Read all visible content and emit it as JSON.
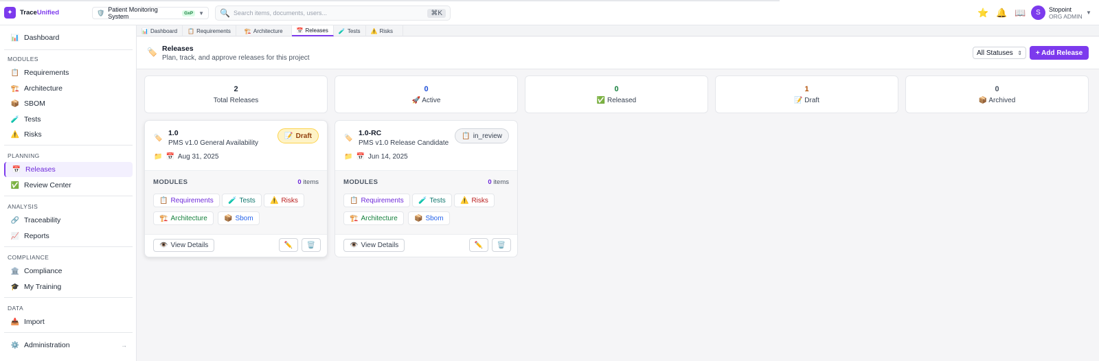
{
  "app": {
    "brand_prefix": "Trace",
    "brand_suffix": "Unified",
    "project": "Patient Monitoring System",
    "project_badge": "GxP",
    "search_placeholder": "Search items, documents, users...",
    "search_shortcut": "⌘K",
    "user_initial": "S",
    "user_name": "Stopoint",
    "user_role": "ORG ADMIN",
    "accent_color": "#7c3aed"
  },
  "sidebar": {
    "dashboard": "Dashboard",
    "sections": {
      "modules": "MODULES",
      "planning": "PLANNING",
      "analysis": "ANALYSIS",
      "compliance": "COMPLIANCE",
      "data": "DATA"
    },
    "items": {
      "requirements": "Requirements",
      "architecture": "Architecture",
      "sbom": "SBOM",
      "tests": "Tests",
      "risks": "Risks",
      "releases": "Releases",
      "review_center": "Review Center",
      "traceability": "Traceability",
      "reports": "Reports",
      "compliance": "Compliance",
      "my_training": "My Training",
      "import": "Import",
      "administration": "Administration"
    }
  },
  "tabs": [
    "Dashboard",
    "Requirements",
    "Architecture",
    "Releases",
    "Tests",
    "Risks"
  ],
  "page": {
    "title": "Releases",
    "subtitle": "Plan, track, and approve releases for this project",
    "status_filter": "All Statuses",
    "add_button": "+ Add Release"
  },
  "stats": [
    {
      "value": "2",
      "label": "Total Releases",
      "icon": "",
      "color": "#111827"
    },
    {
      "value": "0",
      "label": "Active",
      "icon": "🚀",
      "color": "#1d4ed8"
    },
    {
      "value": "0",
      "label": "Released",
      "icon": "✅",
      "color": "#15803d"
    },
    {
      "value": "1",
      "label": "Draft",
      "icon": "📝",
      "color": "#b45309"
    },
    {
      "value": "0",
      "label": "Archived",
      "icon": "📦",
      "color": "#4b5563"
    }
  ],
  "releases": [
    {
      "version": "1.0",
      "name": "PMS v1.0 General Availability",
      "date": "Aug 31, 2025",
      "status": "Draft",
      "modules_label": "MODULES",
      "count": "0",
      "count_unit": "items",
      "modules": [
        "Requirements",
        "Tests",
        "Risks",
        "Architecture",
        "Sbom"
      ],
      "view_label": "View Details"
    },
    {
      "version": "1.0-RC",
      "name": "PMS v1.0 Release Candidate",
      "date": "Jun 14, 2025",
      "status": "in_review",
      "modules_label": "MODULES",
      "count": "0",
      "count_unit": "items",
      "modules": [
        "Requirements",
        "Tests",
        "Risks",
        "Architecture",
        "Sbom"
      ],
      "view_label": "View Details"
    }
  ]
}
